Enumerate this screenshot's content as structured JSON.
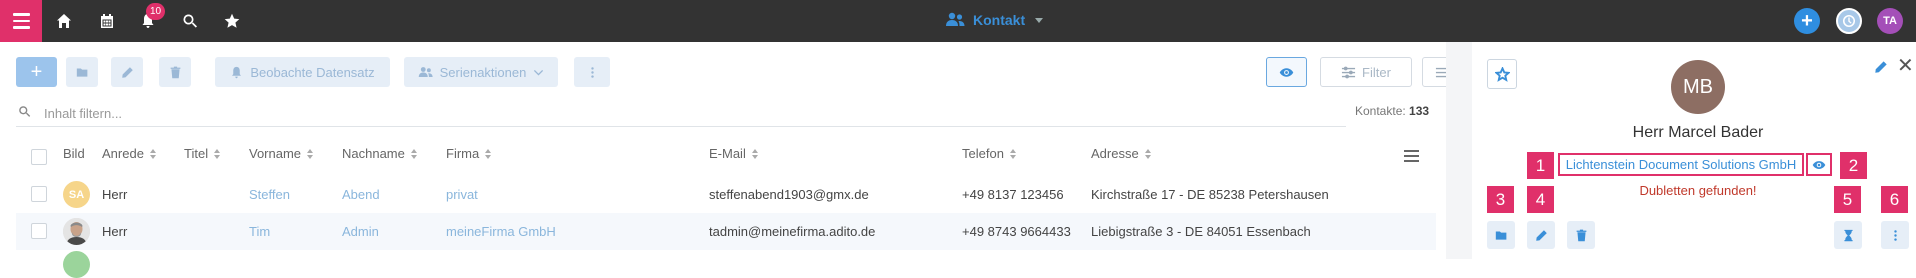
{
  "topbar": {
    "notification_count": "10",
    "context_title": "Kontakt",
    "user_initials": "TA",
    "plus_label": "+",
    "colors": {
      "bar": "#333333",
      "accent": "#e0306a",
      "brand": "#3a8fd8"
    }
  },
  "toolbar": {
    "add_label": "+",
    "watch_label": "Beobachte Datensatz",
    "serial_label": "Serienaktionen",
    "filter_label": "Filter"
  },
  "search": {
    "placeholder": "Inhalt filtern...",
    "count_label": "Kontakte:",
    "count_value": "133"
  },
  "table": {
    "headers": {
      "image": "Bild",
      "salutation": "Anrede",
      "title": "Titel",
      "firstname": "Vorname",
      "lastname": "Nachname",
      "company": "Firma",
      "email": "E-Mail",
      "phone": "Telefon",
      "address": "Adresse"
    },
    "rows": [
      {
        "initials": "SA",
        "salutation": "Herr",
        "title": "",
        "firstname": "Steffen",
        "lastname": "Abend",
        "company": "privat",
        "email": "steffenabend1903@gmx.de",
        "phone": "+49 8137 123456",
        "address": "Kirchstraße 17 - DE 85238 Petershausen"
      },
      {
        "initials": "",
        "salutation": "Herr",
        "title": "",
        "firstname": "Tim",
        "lastname": "Admin",
        "company": "meineFirma GmbH",
        "email": "tadmin@meinefirma.adito.de",
        "phone": "+49 8743 9664433",
        "address": "Liebigstraße 3 - DE 84051 Essenbach"
      }
    ]
  },
  "detail": {
    "avatar_initials": "MB",
    "name": "Herr Marcel Bader",
    "company": "Lichtenstein Document Solutions GmbH",
    "duplicates_text": "Dubletten gefunden!",
    "close_label": "✕",
    "markers": [
      "1",
      "2",
      "3",
      "4",
      "5",
      "6"
    ]
  }
}
